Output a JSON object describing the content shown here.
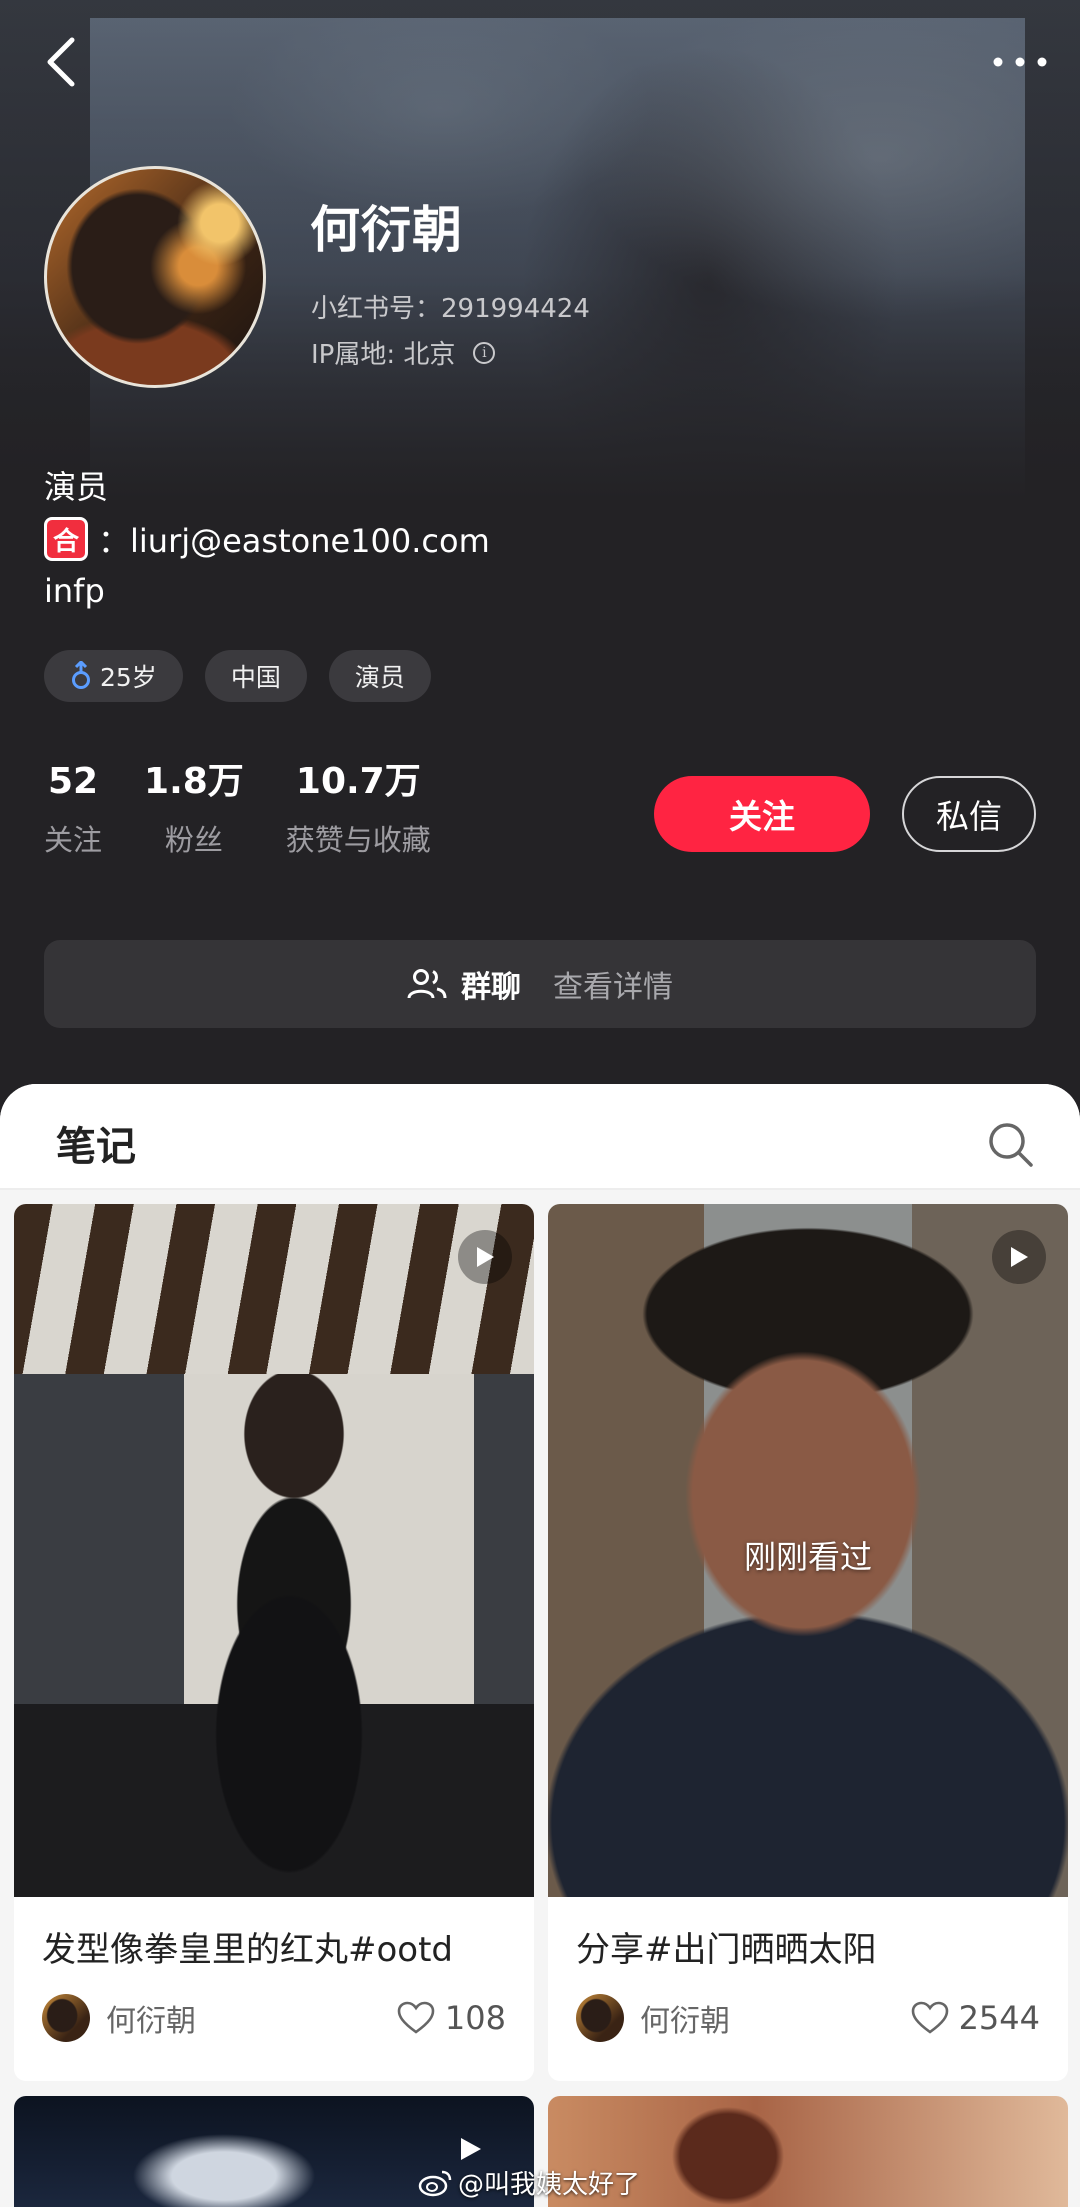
{
  "profile": {
    "name": "何衍朝",
    "red_id": "小红书号：291994424",
    "ip_location": "IP属地: 北京",
    "bio_line1": "演员",
    "bio_he_icon": "合",
    "bio_email": "：liurj@eastone100.com",
    "bio_line3": "infp",
    "tags": [
      "25岁",
      "中国",
      "演员"
    ],
    "gender_icon": "male-icon"
  },
  "stats": [
    {
      "value": "52",
      "label": "关注"
    },
    {
      "value": "1.8万",
      "label": "粉丝"
    },
    {
      "value": "10.7万",
      "label": "获赞与收藏"
    }
  ],
  "actions": {
    "follow_label": "关注",
    "message_label": "私信"
  },
  "group_chat": {
    "title": "群聊",
    "detail": "查看详情"
  },
  "notes": {
    "section_title": "笔记",
    "items": [
      {
        "title": "发型像拳皇里的红丸#ootd",
        "author": "何衍朝",
        "likes": "108",
        "seen": ""
      },
      {
        "title": "分享#出门晒晒太阳",
        "author": "何衍朝",
        "likes": "2544",
        "seen": "刚刚看过"
      }
    ]
  },
  "watermark": "@叫我姨太好了",
  "colors": {
    "accent": "#ff2442",
    "background": "#232225",
    "sheet": "#f5f5f5"
  }
}
